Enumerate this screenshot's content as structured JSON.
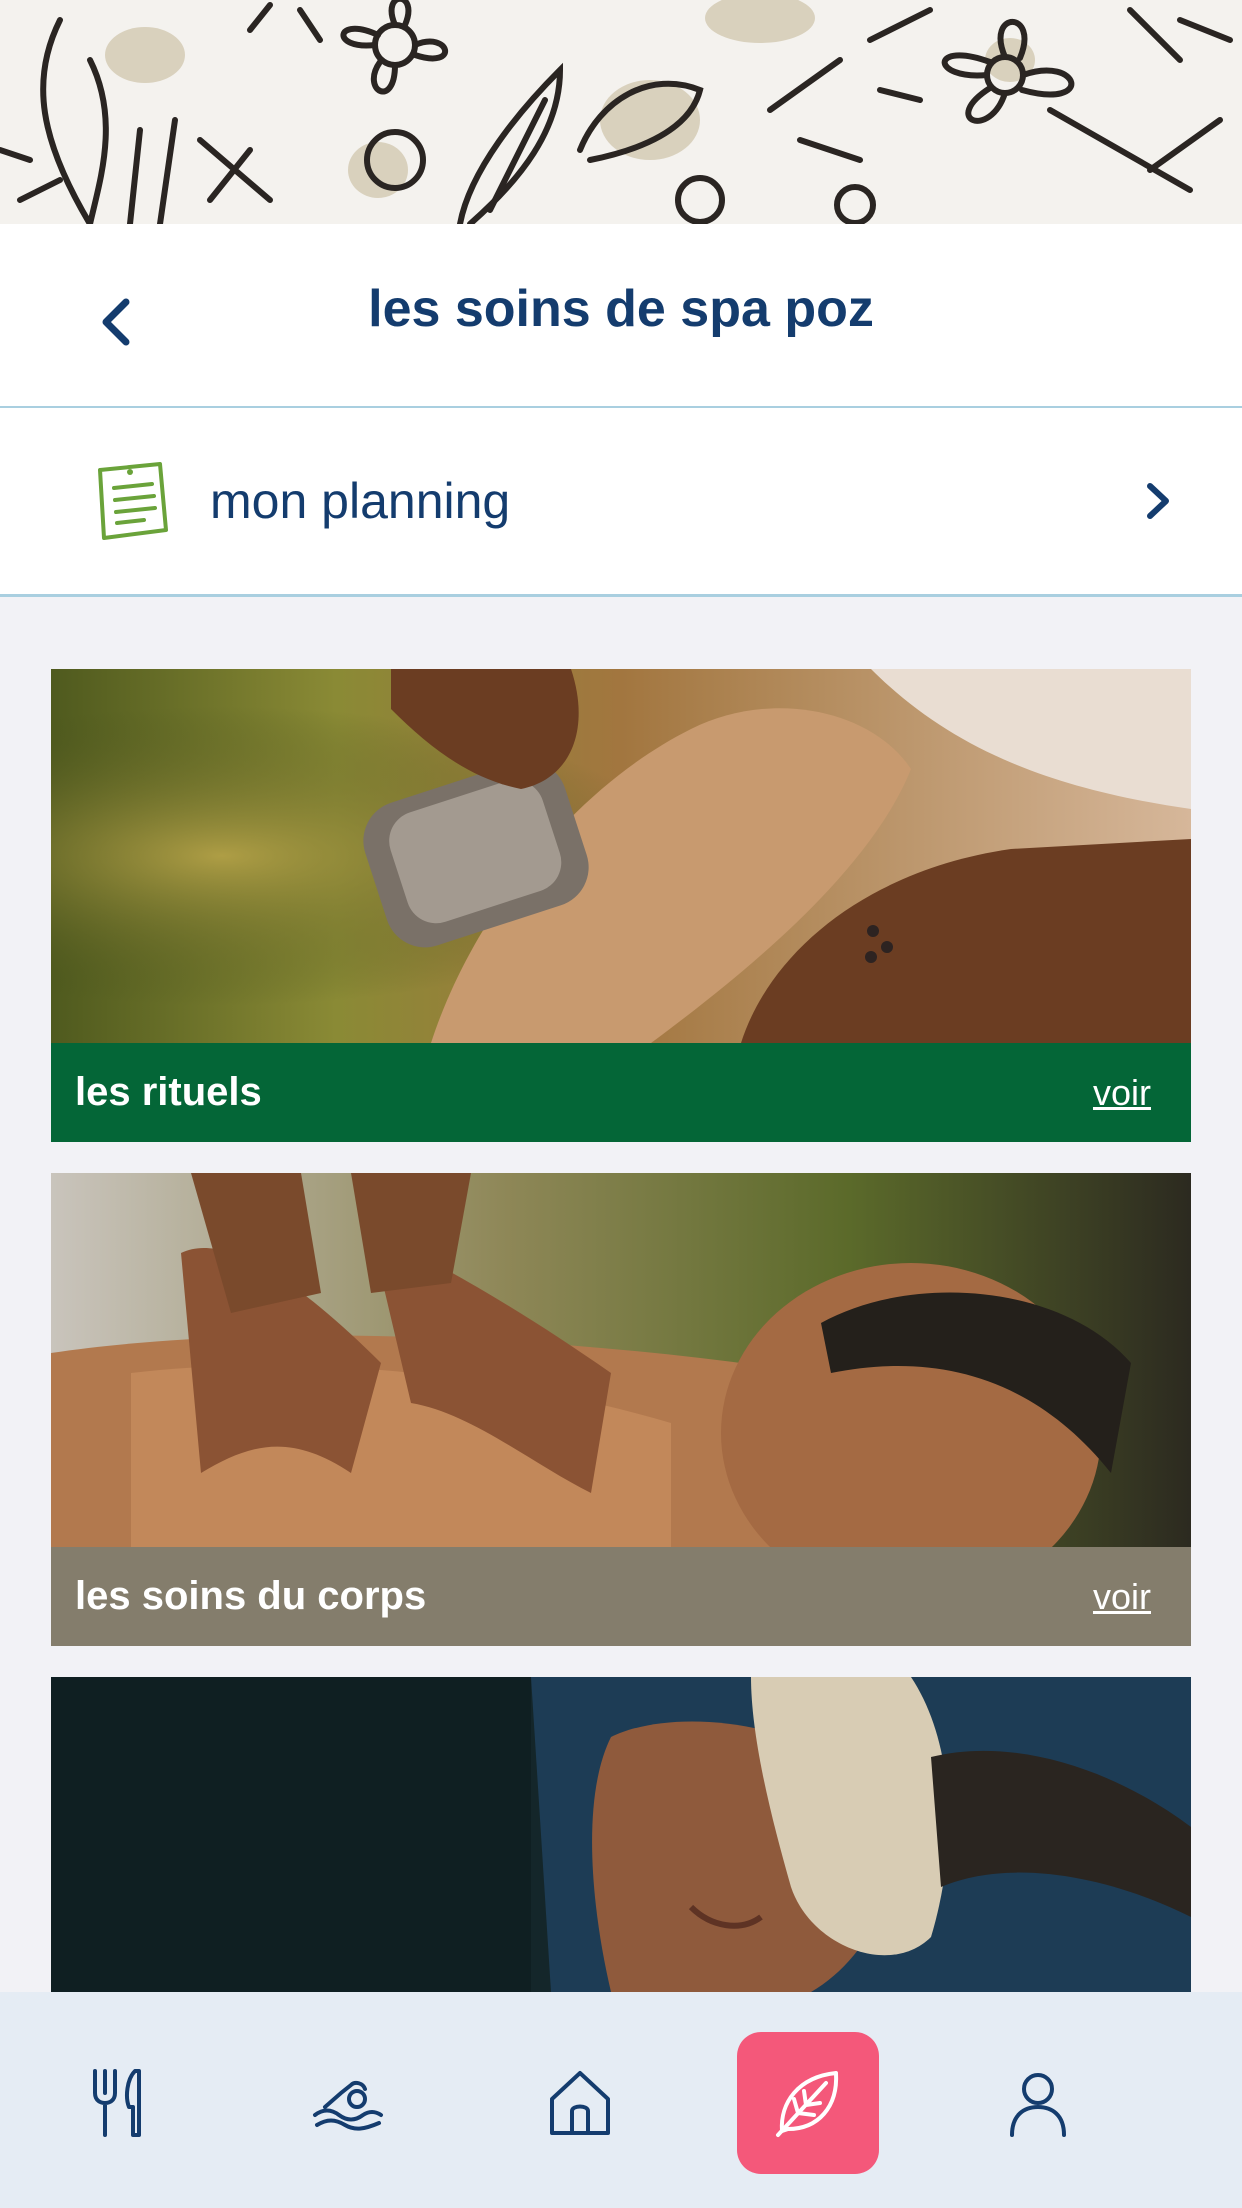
{
  "header": {
    "title": "les soins de spa poz"
  },
  "planning": {
    "label": "mon planning"
  },
  "cards": [
    {
      "title": "les rituels",
      "action": "voir",
      "bar_color": "#046637"
    },
    {
      "title": "les soins du corps",
      "action": "voir",
      "bar_color": "#847d6c"
    },
    {
      "title": "",
      "action": ""
    }
  ],
  "tabbar": {
    "items": [
      {
        "icon": "fork-knife-icon"
      },
      {
        "icon": "swimmer-icon"
      },
      {
        "icon": "home-icon"
      },
      {
        "icon": "leaf-icon",
        "active": true
      },
      {
        "icon": "user-icon"
      }
    ]
  },
  "colors": {
    "primary": "#143c6e",
    "accent": "#f4587a",
    "divider": "#a9cfe0"
  }
}
